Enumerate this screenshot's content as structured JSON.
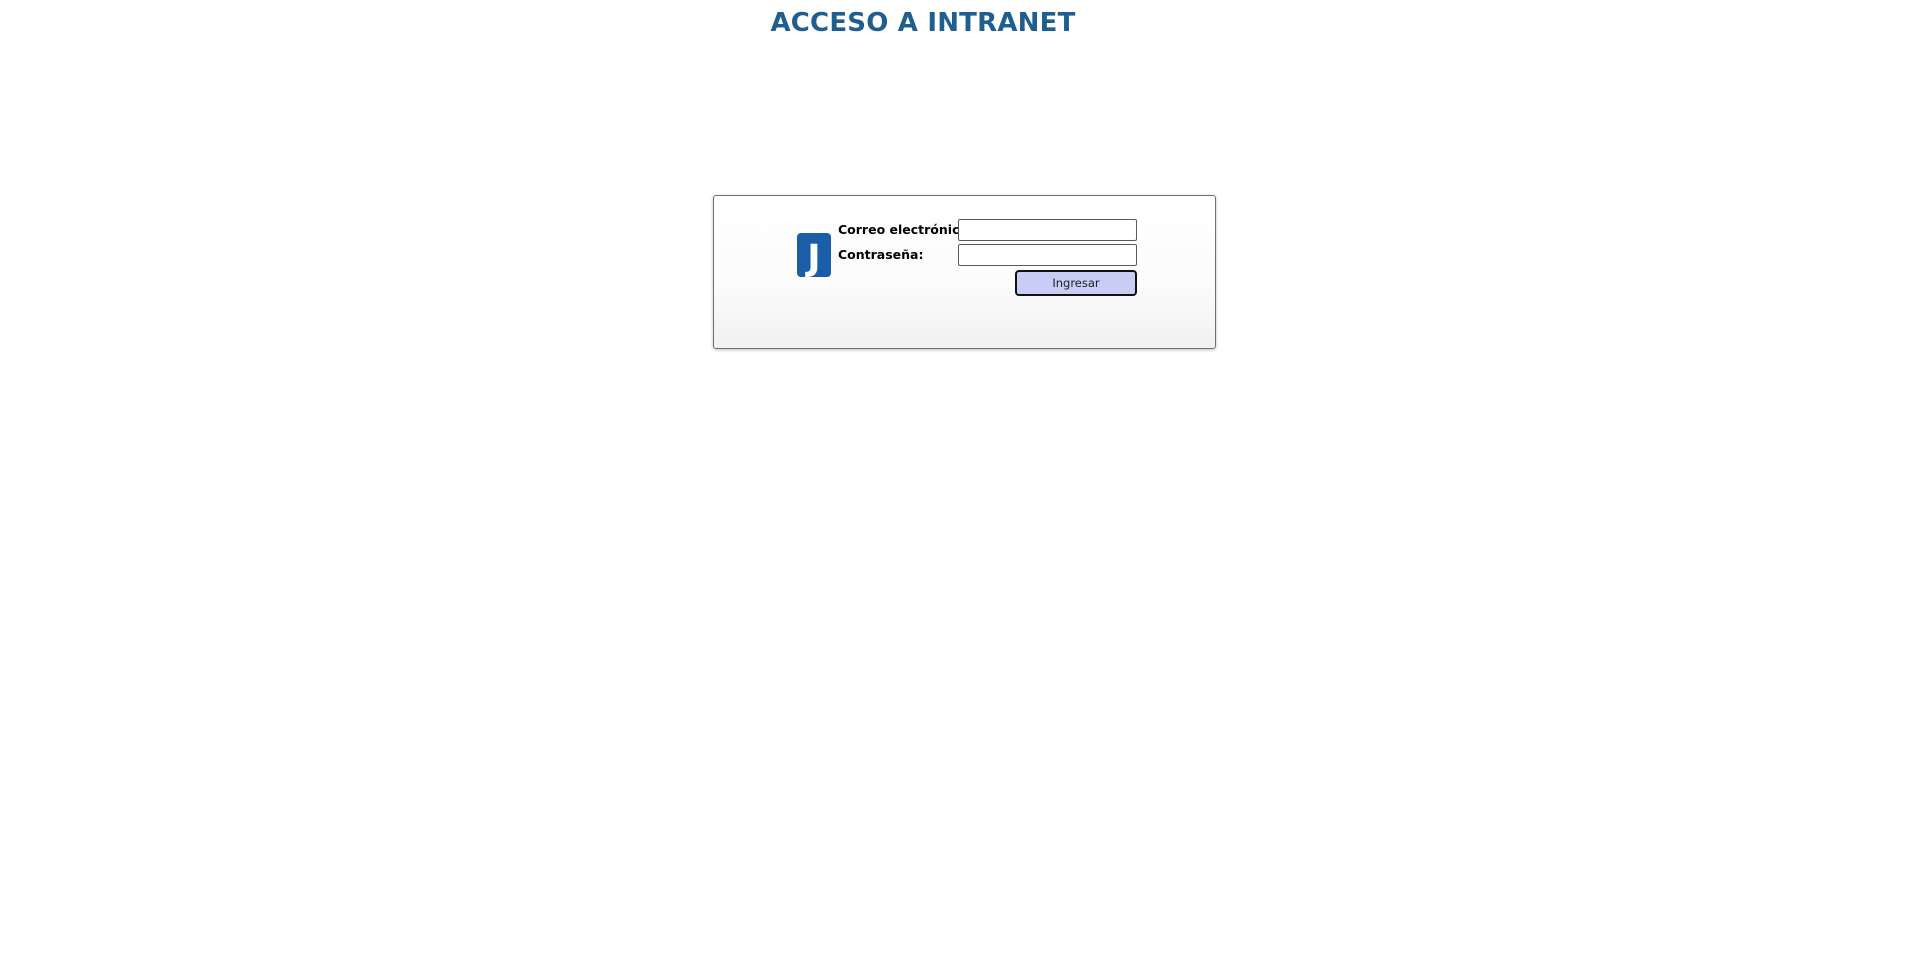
{
  "header": {
    "title": "ACCESO A INTRANET"
  },
  "login": {
    "logo_icon": "j-logo-icon",
    "logo_letter": "J",
    "email_label": "Correo electrónico:",
    "email_value": "",
    "password_label": "Contraseña:",
    "password_value": "",
    "submit_label": "Ingresar"
  },
  "colors": {
    "title": "#1f5f8f",
    "logo": "#1a5ea8",
    "button_bg": "#c8cdf5"
  }
}
